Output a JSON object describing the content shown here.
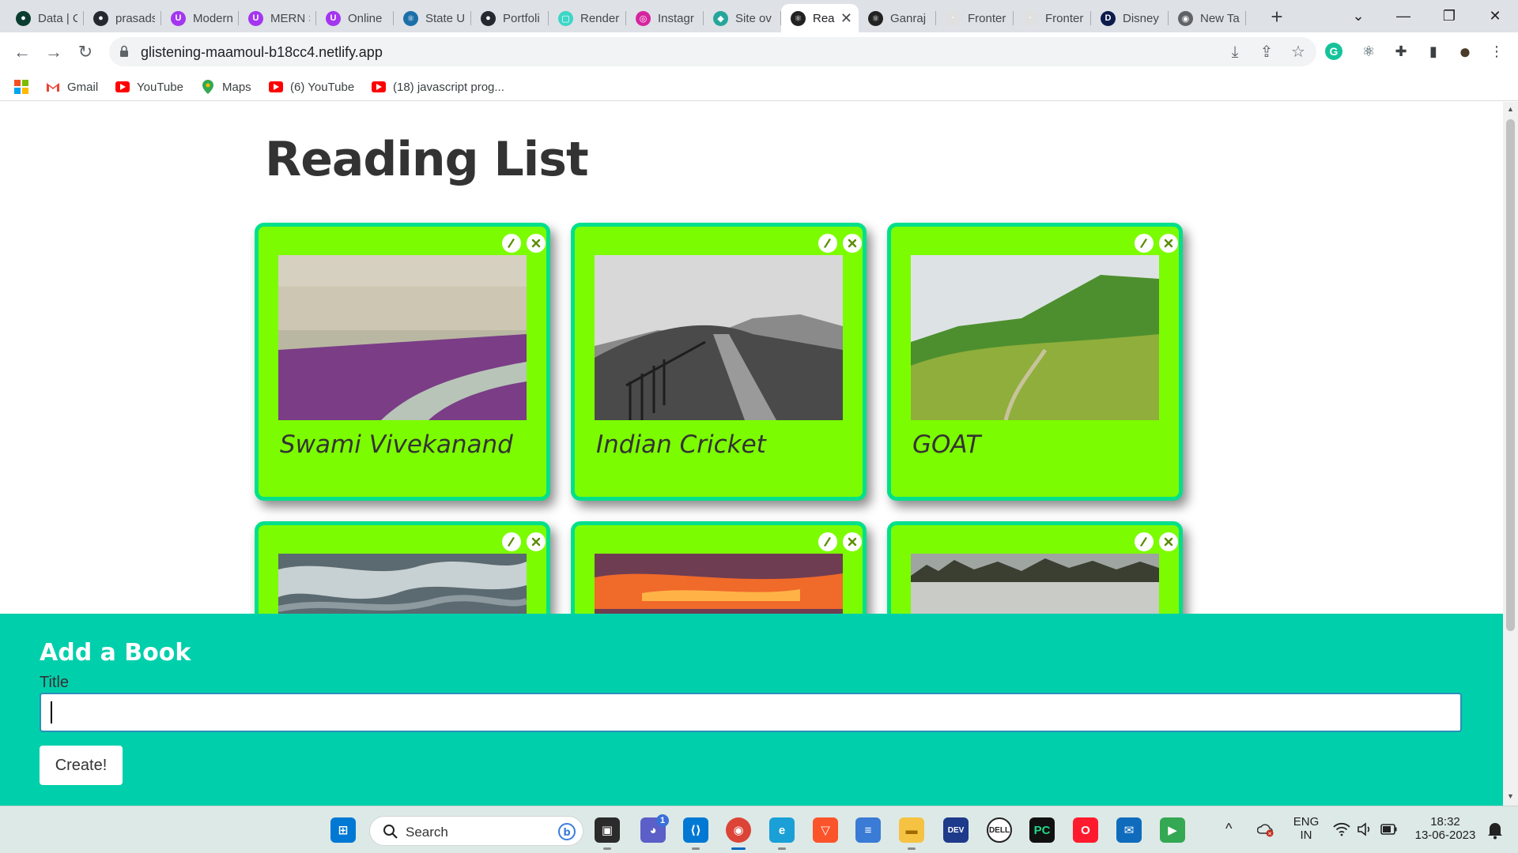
{
  "browser": {
    "tabs": [
      {
        "title": "Data | C",
        "fav_color": "#0b3d2e",
        "fav_glyph": "●"
      },
      {
        "title": "prasads",
        "fav_color": "#24292f",
        "fav_glyph": "●"
      },
      {
        "title": "Modern",
        "fav_color": "#a435f0",
        "fav_glyph": "U"
      },
      {
        "title": "MERN S",
        "fav_color": "#a435f0",
        "fav_glyph": "U"
      },
      {
        "title": "Online",
        "fav_color": "#a435f0",
        "fav_glyph": "U"
      },
      {
        "title": "State U",
        "fav_color": "#1b6fa8",
        "fav_glyph": "⚛"
      },
      {
        "title": "Portfoli",
        "fav_color": "#24292f",
        "fav_glyph": "●"
      },
      {
        "title": "Render",
        "fav_color": "#3dd6c6",
        "fav_glyph": "▢"
      },
      {
        "title": "Instagr",
        "fav_color": "#d6249f",
        "fav_glyph": "◎"
      },
      {
        "title": "Site ov",
        "fav_color": "#26a69a",
        "fav_glyph": "◆"
      },
      {
        "title": "Rea",
        "fav_color": "#222222",
        "fav_glyph": "⚛",
        "active": true
      },
      {
        "title": "Ganraj",
        "fav_color": "#222222",
        "fav_glyph": "⚛"
      },
      {
        "title": "Fronter",
        "fav_color": "#e0e0e0",
        "fav_glyph": "·"
      },
      {
        "title": "Fronter",
        "fav_color": "#e0e0e0",
        "fav_glyph": "·"
      },
      {
        "title": "Disney",
        "fav_color": "#0d1a4a",
        "fav_glyph": "D"
      },
      {
        "title": "New Ta",
        "fav_color": "#5f6368",
        "fav_glyph": "◉"
      }
    ],
    "tab_close_glyph": "✕",
    "new_tab_glyph": "+",
    "window_controls": {
      "tabsearch": "⌄",
      "minimize": "—",
      "maximize": "❐",
      "close": "✕"
    },
    "nav": {
      "back": "←",
      "forward": "→",
      "reload": "↻"
    },
    "url": "glistening-maamoul-b18cc4.netlify.app",
    "omnibox_icons": {
      "install": "⤓",
      "share": "⇪",
      "bookmark": "☆"
    },
    "extensions": [
      {
        "name": "grammarly-extension-icon",
        "glyph": "G",
        "color": "#15c39a"
      },
      {
        "name": "react-devtools-extension-icon",
        "glyph": "⚛",
        "color": "#1f3a44"
      },
      {
        "name": "puzzle-extensions-icon",
        "glyph": "✚",
        "color": "#3c4043"
      },
      {
        "name": "sidepanel-icon",
        "glyph": "▮",
        "color": "#3c4043"
      },
      {
        "name": "profile-avatar-icon",
        "glyph": "●",
        "color": "#4a3b2a"
      },
      {
        "name": "kebab-menu-icon",
        "glyph": "⋮",
        "color": "#3c4043"
      }
    ],
    "bookmarks": [
      {
        "label": "",
        "icon": "apps-grid-icon",
        "color": "#f25022"
      },
      {
        "label": "Gmail",
        "icon": "gmail-icon",
        "color": "#ea4335"
      },
      {
        "label": "YouTube",
        "icon": "youtube-icon",
        "color": "#ff0000"
      },
      {
        "label": "Maps",
        "icon": "maps-pin-icon",
        "color": "#34a853"
      },
      {
        "label": "(6) YouTube",
        "icon": "youtube-icon",
        "color": "#ff0000"
      },
      {
        "label": "(18) javascript prog...",
        "icon": "youtube-icon",
        "color": "#ff0000"
      }
    ]
  },
  "page": {
    "title": "Reading List",
    "books": [
      {
        "title": "Swami Vivekanand",
        "image": "beach-photo",
        "sky": "#ccc6b2",
        "ground": "#7a3d86",
        "accent": "#b7c4b7"
      },
      {
        "title": "Indian Cricket",
        "image": "bw-hill-photo",
        "sky": "#d8d8d8",
        "ground": "#4a4a4a",
        "accent": "#9a9a9a"
      },
      {
        "title": "GOAT",
        "image": "green-mountain-photo",
        "sky": "#dde3e5",
        "ground": "#8fae3c",
        "accent": "#4d8f2e"
      },
      {
        "title": "",
        "image": "water-photo",
        "sky": "#8d9aa0",
        "ground": "#5a6a70",
        "accent": "#c7d0d2"
      },
      {
        "title": "",
        "image": "sunset-photo",
        "sky": "#6f3d52",
        "ground": "#f06a2a",
        "accent": "#ffb347"
      },
      {
        "title": "",
        "image": "misty-field-photo",
        "sky": "#9fa5a0",
        "ground": "#c8cbc6",
        "accent": "#3a3f32"
      }
    ],
    "edit_glyph": "✎",
    "delete_glyph": "✕",
    "form": {
      "heading": "Add a Book",
      "title_label": "Title",
      "title_value": "",
      "title_placeholder": "",
      "create_label": "Create!"
    },
    "colors": {
      "card_bg": "#7cfc00",
      "card_border": "#00e08a",
      "panel_bg": "#00cfac"
    }
  },
  "taskbar": {
    "search_label": "Search",
    "apps": [
      {
        "name": "start-windows-icon",
        "glyph": "⊞",
        "color": "#0078d4",
        "fg": "#ffffff"
      },
      {
        "name": "task-view-icon",
        "glyph": "▣",
        "color": "#2b2b2b",
        "fg": "#ffffff"
      },
      {
        "name": "teams-chat-icon",
        "glyph": "◕",
        "color": "#5b5fc7",
        "fg": "#ffffff"
      },
      {
        "name": "vscode-icon",
        "glyph": "⟨⟩",
        "color": "#0078d4",
        "fg": "#ffffff"
      },
      {
        "name": "chrome-icon",
        "glyph": "◉",
        "color": "#db4437",
        "fg": "#ffffff"
      },
      {
        "name": "edge-icon",
        "glyph": "e",
        "color": "#1a9fd6",
        "fg": "#ffffff"
      },
      {
        "name": "brave-icon",
        "glyph": "▽",
        "color": "#fb542b",
        "fg": "#ffffff"
      },
      {
        "name": "notepad-icon",
        "glyph": "≡",
        "color": "#3a7bd5",
        "fg": "#ffffff"
      },
      {
        "name": "file-explorer-icon",
        "glyph": "▬",
        "color": "#f5c242",
        "fg": "#a06a00"
      },
      {
        "name": "dev-cpp-icon",
        "glyph": "DEV",
        "color": "#1e3a8a",
        "fg": "#ffffff"
      },
      {
        "name": "dell-icon",
        "glyph": "DELL",
        "color": "#ffffff",
        "fg": "#222222"
      },
      {
        "name": "pycharm-icon",
        "glyph": "PC",
        "color": "#111111",
        "fg": "#21d789"
      },
      {
        "name": "opera-icon",
        "glyph": "O",
        "color": "#ff1b2d",
        "fg": "#ffffff"
      },
      {
        "name": "mail-icon",
        "glyph": "✉",
        "color": "#0f6cbd",
        "fg": "#ffffff"
      },
      {
        "name": "meet-icon",
        "glyph": "▶",
        "color": "#34a853",
        "fg": "#ffffff"
      }
    ],
    "teams_badge": "1",
    "tray": {
      "chevron": "^",
      "language_top": "ENG",
      "language_bottom": "IN",
      "time": "18:32",
      "date": "13-06-2023"
    }
  }
}
